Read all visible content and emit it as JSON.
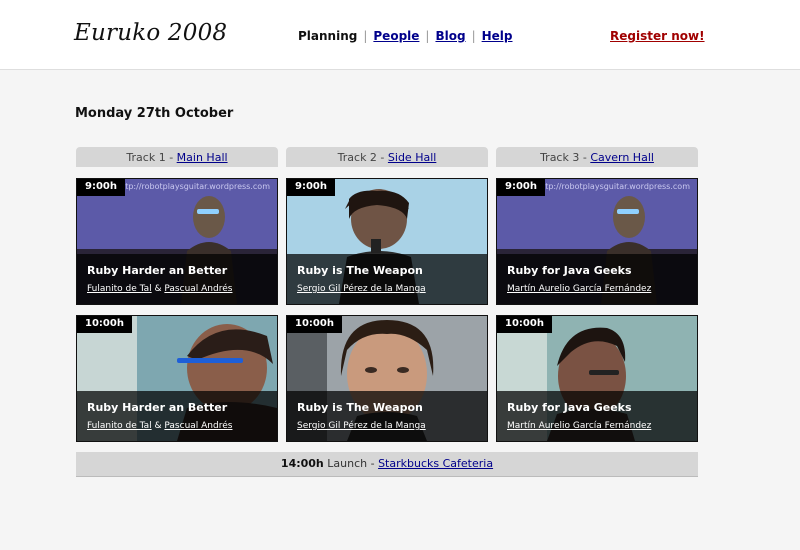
{
  "header": {
    "logo": "Euruko 2008",
    "nav": {
      "current": "Planning",
      "links": [
        "People",
        "Blog",
        "Help"
      ]
    },
    "register": "Register now!"
  },
  "day": {
    "title": "Monday 27th October"
  },
  "tracks": [
    {
      "prefix": "Track 1 - ",
      "venue": "Main Hall"
    },
    {
      "prefix": "Track 2 - ",
      "venue": "Side Hall"
    },
    {
      "prefix": "Track 3 - ",
      "venue": "Cavern Hall"
    }
  ],
  "sessions": [
    {
      "time": "9:00h",
      "title": "Ruby Harder an Better",
      "speaker1": "Fulanito de Tal",
      "joiner": " & ",
      "speaker2": "Pascual Andrés"
    },
    {
      "time": "9:00h",
      "title": "Ruby is The Weapon",
      "speaker1": "Sergio Gil Pérez de la Manga"
    },
    {
      "time": "9:00h",
      "title": "Ruby for Java Geeks",
      "speaker1": "Martín Aurelio García Fernández"
    },
    {
      "time": "10:00h",
      "title": "Ruby Harder an Better",
      "speaker1": "Fulanito de Tal",
      "joiner": " & ",
      "speaker2": "Pascual Andrés"
    },
    {
      "time": "10:00h",
      "title": "Ruby is The Weapon",
      "speaker1": "Sergio Gil Pérez de la Manga"
    },
    {
      "time": "10:00h",
      "title": "Ruby for Java Geeks",
      "speaker1": "Martín Aurelio García Fernández"
    }
  ],
  "photo_text": "http://robotplaysguitar.wordpress.com",
  "lunch": {
    "time": "14:00h",
    "text": " Launch - ",
    "place": "Starkbucks Cafeteria"
  },
  "colors": {
    "link": "#00008b",
    "register": "#a00000",
    "track_bar": "#d6d6d6",
    "background": "#f5f5f5"
  }
}
